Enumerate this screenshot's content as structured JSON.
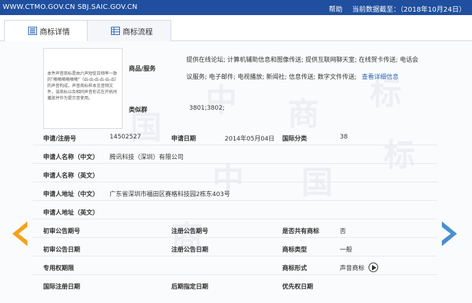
{
  "topbar": {
    "url": "WWW.CTMO.GOV.CN SBJ.SAIC.GOV.CN",
    "help": "帮助",
    "data_date": "当前数据截至：（2018年10月24日）"
  },
  "tabs": [
    {
      "label": "商标详情",
      "icon": "document-icon",
      "active": true
    },
    {
      "label": "商标流程",
      "icon": "grid-icon",
      "active": false
    }
  ],
  "trademark_image": {
    "text": "本件声音商标是由六声短促且频率一致的\"嘀嘀嘀嘀嘀嘀\"（di-di-di-di-di-di）的声音构成，声音商标样本见音频文件，该商标以及相同声音形式在开机时播放并作为提示音使用。"
  },
  "goods": {
    "label": "商品/服务",
    "value_line1": "提供在线论坛; 计算机辅助信息和图像传送; 提供互联网聊天室; 在线贺卡传送; 电话会",
    "value_line2": "议服务; 电子邮件; 电视播放; 新闻社; 信息传送; 数字文件传送;",
    "detail_link": "查看详细信息"
  },
  "similar_group": {
    "label": "类似群",
    "value": "3801;3802;"
  },
  "fields": {
    "reg_no_label": "申请/注册号",
    "reg_no": "14502527",
    "app_date_label": "申请日期",
    "app_date": "2014年05月04日",
    "intl_class_label": "国际分类",
    "intl_class": "38",
    "applicant_cn_label": "申请人名称（中文）",
    "applicant_cn": "腾讯科技（深圳）有限公司",
    "applicant_en_label": "申请人名称（英文）",
    "applicant_en": "",
    "address_cn_label": "申请人地址（中文）",
    "address_cn": "广东省深圳市福田区赛格科技园2栋东403号",
    "address_en_label": "申请人地址（英文）",
    "address_en": "",
    "prelim_pub_no_label": "初审公告期号",
    "prelim_pub_no": "",
    "reg_pub_no_label": "注册公告期号",
    "reg_pub_no": "",
    "shared_label": "是否共有商标",
    "shared": "否",
    "prelim_pub_date_label": "初审公告日期",
    "prelim_pub_date": "",
    "reg_pub_date_label": "注册公告日期",
    "reg_pub_date": "",
    "tm_type_label": "商标类型",
    "tm_type": "一般",
    "exclusive_period_label": "专用权期限",
    "exclusive_period": "",
    "tm_form_label": "商标形式",
    "tm_form": "声音商标",
    "intl_reg_date_label": "国际注册日期",
    "intl_reg_date": "",
    "later_designation_label": "后期指定日期",
    "later_designation": "",
    "priority_date_label": "优先权日期",
    "priority_date": ""
  },
  "watermark": [
    "中",
    "国",
    "商",
    "标"
  ],
  "colors": {
    "topbar": "#1f4f9e",
    "link": "#2a64b5",
    "arrow_left": "#f5a21b",
    "arrow_right": "#4a8fd0"
  }
}
